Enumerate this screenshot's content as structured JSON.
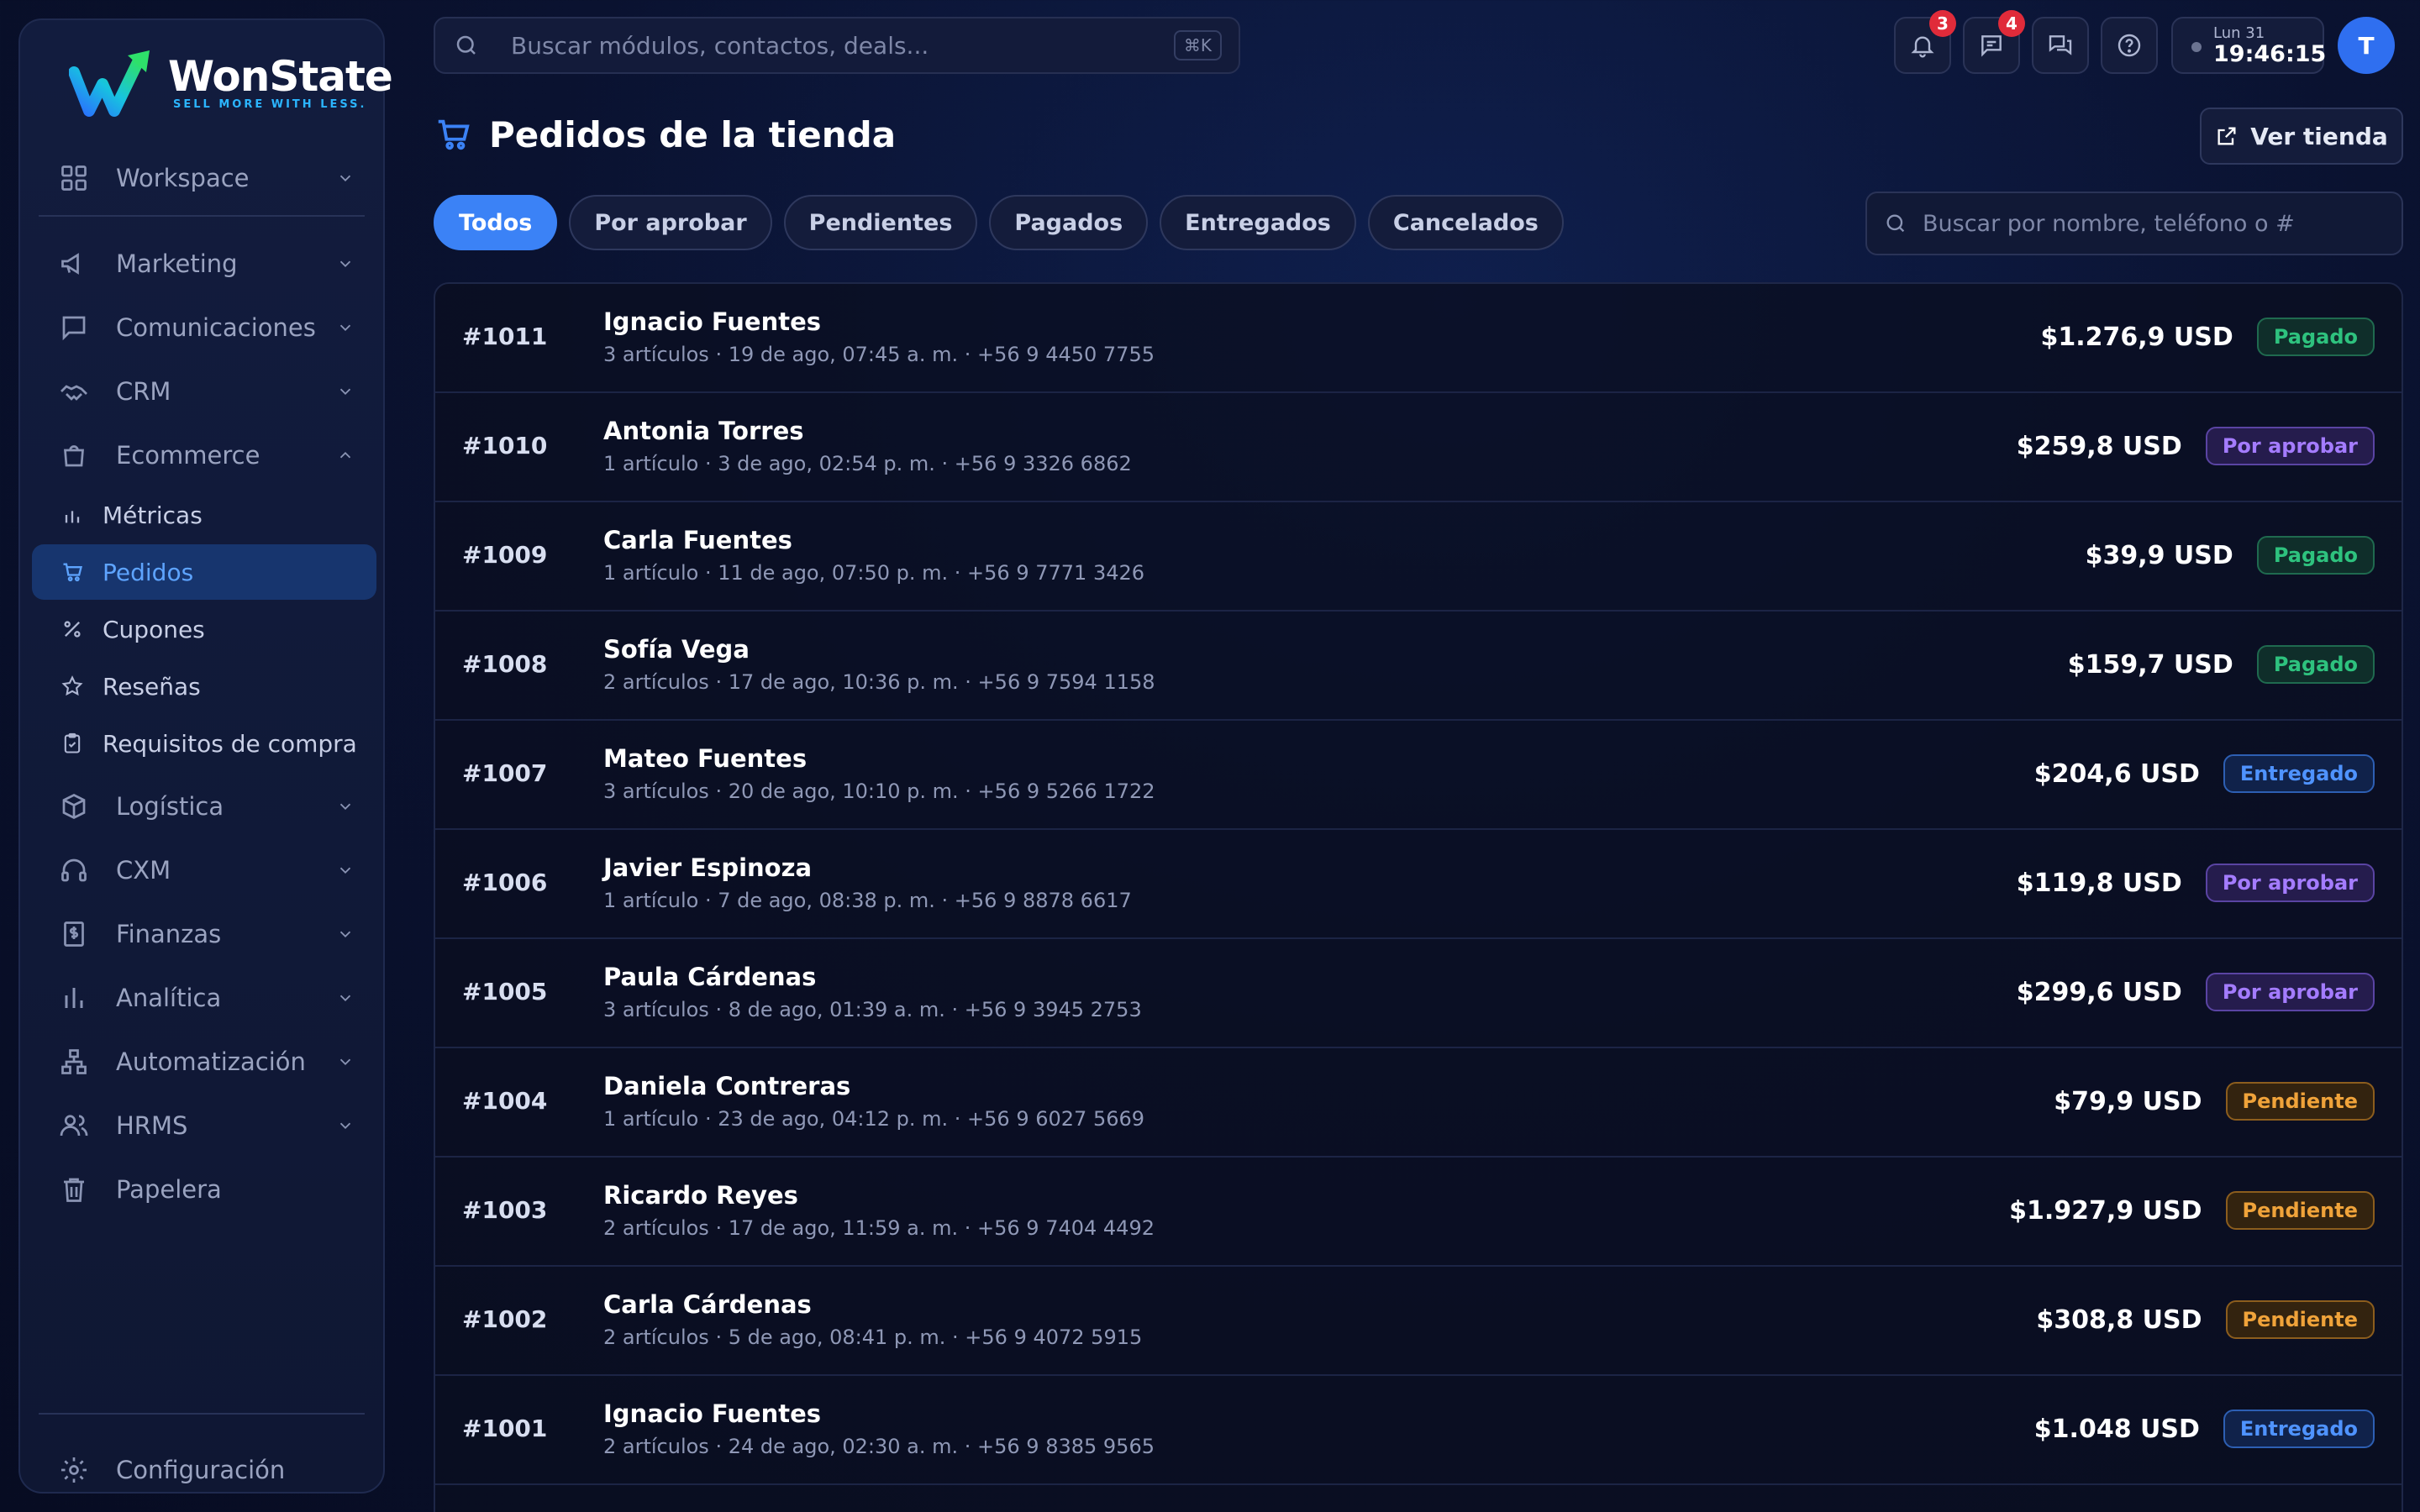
{
  "brand": {
    "name": "WonState",
    "tagline": "SELL MORE WITH LESS."
  },
  "sidebar": {
    "workspace": "Workspace",
    "groups": [
      {
        "label": "Marketing",
        "icon": "megaphone-icon"
      },
      {
        "label": "Comunicaciones",
        "icon": "chat-icon"
      },
      {
        "label": "CRM",
        "icon": "handshake-icon"
      },
      {
        "label": "Ecommerce",
        "icon": "shopping-bag-icon"
      }
    ],
    "ecommerce_items": [
      {
        "label": "Métricas",
        "icon": "bar-chart-icon"
      },
      {
        "label": "Pedidos",
        "icon": "cart-icon"
      },
      {
        "label": "Cupones",
        "icon": "percent-icon"
      },
      {
        "label": "Reseñas",
        "icon": "star-icon"
      },
      {
        "label": "Requisitos de compra",
        "icon": "clipboard-icon"
      }
    ],
    "lower_groups": [
      {
        "label": "Logística",
        "icon": "package-icon"
      },
      {
        "label": "CXM",
        "icon": "headphones-icon"
      },
      {
        "label": "Finanzas",
        "icon": "dollar-receipt-icon"
      },
      {
        "label": "Analítica",
        "icon": "analytics-icon"
      },
      {
        "label": "Automatización",
        "icon": "workflow-icon"
      },
      {
        "label": "HRMS",
        "icon": "users-icon"
      }
    ],
    "trash": "Papelera",
    "settings": "Configuración"
  },
  "topbar": {
    "search_placeholder": "Buscar módulos, contactos, deals...",
    "shortcut": "⌘K",
    "notifications_count": "3",
    "messages_count": "4",
    "clock_day": "Lun 31",
    "clock_time": "19:46:15",
    "avatar_initial": "T"
  },
  "page": {
    "title": "Pedidos de la tienda",
    "view_store": "Ver tienda",
    "tabs": [
      "Todos",
      "Por aprobar",
      "Pendientes",
      "Pagados",
      "Entregados",
      "Cancelados"
    ],
    "orders_search_placeholder": "Buscar por nombre, teléfono o #"
  },
  "orders": [
    {
      "num": "#1011",
      "name": "Ignacio Fuentes",
      "meta": "3 artículos · 19 de ago, 07:45 a. m. · +56 9 4450 7755",
      "amount": "$1.276,9 USD",
      "status": "Pagado"
    },
    {
      "num": "#1010",
      "name": "Antonia Torres",
      "meta": "1 artículo · 3 de ago, 02:54 p. m. · +56 9 3326 6862",
      "amount": "$259,8 USD",
      "status": "Por aprobar"
    },
    {
      "num": "#1009",
      "name": "Carla Fuentes",
      "meta": "1 artículo · 11 de ago, 07:50 p. m. · +56 9 7771 3426",
      "amount": "$39,9 USD",
      "status": "Pagado"
    },
    {
      "num": "#1008",
      "name": "Sofía Vega",
      "meta": "2 artículos · 17 de ago, 10:36 p. m. · +56 9 7594 1158",
      "amount": "$159,7 USD",
      "status": "Pagado"
    },
    {
      "num": "#1007",
      "name": "Mateo Fuentes",
      "meta": "3 artículos · 20 de ago, 10:10 p. m. · +56 9 5266 1722",
      "amount": "$204,6 USD",
      "status": "Entregado"
    },
    {
      "num": "#1006",
      "name": "Javier Espinoza",
      "meta": "1 artículo · 7 de ago, 08:38 p. m. · +56 9 8878 6617",
      "amount": "$119,8 USD",
      "status": "Por aprobar"
    },
    {
      "num": "#1005",
      "name": "Paula Cárdenas",
      "meta": "3 artículos · 8 de ago, 01:39 a. m. · +56 9 3945 2753",
      "amount": "$299,6 USD",
      "status": "Por aprobar"
    },
    {
      "num": "#1004",
      "name": "Daniela Contreras",
      "meta": "1 artículo · 23 de ago, 04:12 p. m. · +56 9 6027 5669",
      "amount": "$79,9 USD",
      "status": "Pendiente"
    },
    {
      "num": "#1003",
      "name": "Ricardo Reyes",
      "meta": "2 artículos · 17 de ago, 11:59 a. m. · +56 9 7404 4492",
      "amount": "$1.927,9 USD",
      "status": "Pendiente"
    },
    {
      "num": "#1002",
      "name": "Carla Cárdenas",
      "meta": "2 artículos · 5 de ago, 08:41 p. m. · +56 9 4072 5915",
      "amount": "$308,8 USD",
      "status": "Pendiente"
    },
    {
      "num": "#1001",
      "name": "Ignacio Fuentes",
      "meta": "2 artículos · 24 de ago, 02:30 a. m. · +56 9 8385 9565",
      "amount": "$1.048 USD",
      "status": "Entregado"
    }
  ],
  "colors": {
    "accent": "#3b82f6",
    "badge": "#e02b3a",
    "pagado": "#2ec27e",
    "por_aprobar": "#a47cff",
    "entregado": "#4f93ff",
    "pendiente": "#f0a33a"
  }
}
